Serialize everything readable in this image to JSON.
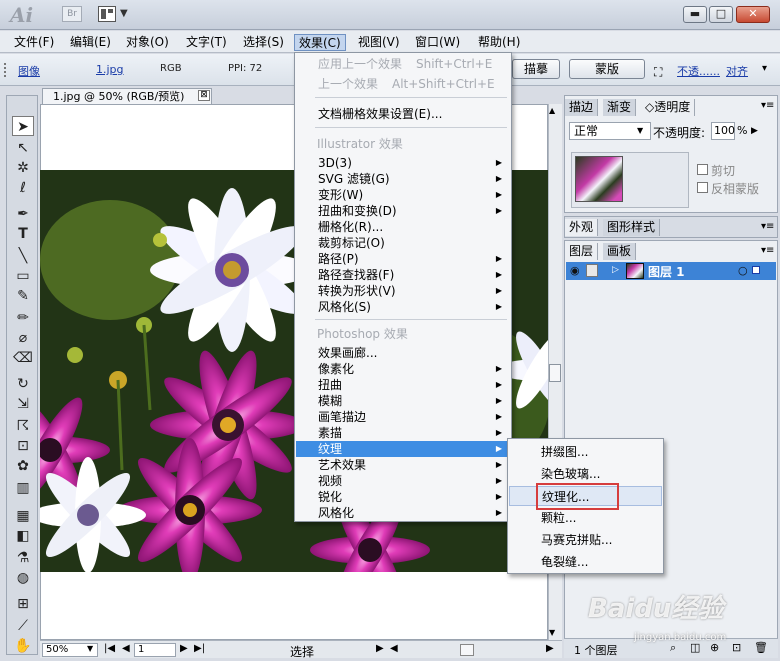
{
  "titlebar": {
    "app_logo": "Ai",
    "bridge_label": "Br",
    "min": "▬",
    "max": "□",
    "close": "✕"
  },
  "menubar": [
    "文件(F)",
    "编辑(E)",
    "对象(O)",
    "文字(T)",
    "选择(S)",
    "效果(C)",
    "视图(V)",
    "窗口(W)",
    "帮助(H)"
  ],
  "controlbar": {
    "image_link": "图像",
    "file_link": "1.jpg",
    "color_mode": "RGB",
    "ppi": "PPI: 72",
    "trace_button": "描摹",
    "mask_button": "蒙版",
    "opacity_link": "不透......",
    "align_link": "对齐"
  },
  "document": {
    "tab_title": "1.jpg @ 50% (RGB/预览)",
    "tab_close": "⊠"
  },
  "statusbar": {
    "zoom": "50%",
    "page": "1",
    "mode": "选择"
  },
  "panel_top": {
    "tabs": [
      "描边",
      "渐变",
      "◇透明度"
    ],
    "blend_mode": "正常",
    "opacity_label": "不透明度:",
    "opacity_value": "100",
    "opacity_unit": "%",
    "clip_label": "剪切",
    "invert_label": "反相蒙版"
  },
  "panel_mid": {
    "tabs": [
      "外观",
      "图形样式"
    ]
  },
  "panel_layers": {
    "tabs": [
      "图层",
      "画板"
    ],
    "layer_name": "图层 1",
    "footer_count": "1 个图层"
  },
  "effect_menu": {
    "repeat_last": "应用上一个效果",
    "repeat_last_sc": "Shift+Ctrl+E",
    "last_effect": "上一个效果",
    "last_effect_sc": "Alt+Shift+Ctrl+E",
    "raster_settings": "文档栅格效果设置(E)...",
    "illustrator_header": "Illustrator 效果",
    "illustrator_items": [
      "3D(3)",
      "SVG 滤镜(G)",
      "变形(W)",
      "扭曲和变换(D)",
      "栅格化(R)...",
      "裁剪标记(O)",
      "路径(P)",
      "路径查找器(F)",
      "转换为形状(V)",
      "风格化(S)"
    ],
    "photoshop_header": "Photoshop 效果",
    "photoshop_items": [
      "效果画廊...",
      "像素化",
      "扭曲",
      "模糊",
      "画笔描边",
      "素描",
      "纹理",
      "艺术效果",
      "视频",
      "锐化",
      "风格化"
    ]
  },
  "texture_menu": [
    "拼缀图...",
    "染色玻璃...",
    "纹理化...",
    "颗粒...",
    "马赛克拼贴...",
    "龟裂缝..."
  ],
  "watermark": {
    "brand": "Baidu经验",
    "url": "jingyan.baidu.com"
  },
  "colors": {
    "highlight": "#3e8de3",
    "callout": "#d63d3d",
    "layer_selected": "#3d83d6"
  }
}
